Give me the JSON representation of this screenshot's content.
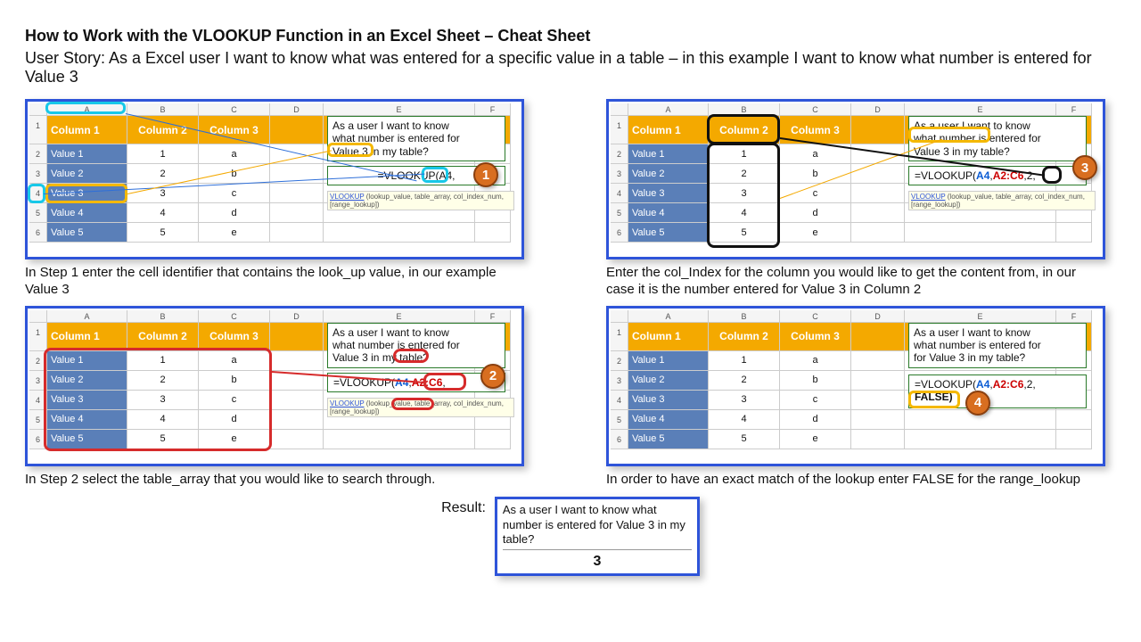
{
  "title": "How to Work with the VLOOKUP Function in an Excel Sheet – Cheat Sheet",
  "story": "User Story: As a Excel user I want to know what was entered for a specific value in a table – in this example I want to know what number is entered for Value 3",
  "columns": {
    "A": "A",
    "B": "B",
    "C": "C",
    "D": "D",
    "E": "E",
    "F": "F"
  },
  "rows": [
    "1",
    "2",
    "3",
    "4",
    "5",
    "6"
  ],
  "table": {
    "headers": {
      "c1": "Column 1",
      "c2": "Column 2",
      "c3": "Column 3"
    },
    "data": [
      {
        "c1": "Value 1",
        "c2": "1",
        "c3": "a"
      },
      {
        "c1": "Value 2",
        "c2": "2",
        "c3": "b"
      },
      {
        "c1": "Value 3",
        "c2": "3",
        "c3": "c"
      },
      {
        "c1": "Value 4",
        "c2": "4",
        "c3": "d"
      },
      {
        "c1": "Value 5",
        "c2": "5",
        "c3": "e"
      }
    ]
  },
  "storybox": {
    "line_full": "As a user I want to know what number is entered for Value 3 in my table?",
    "line_a": "As a user I want to know",
    "line_b": "what number is entered for",
    "line_c": "Value 3 in my table?",
    "line_c_prefix": "Value 3",
    "line_c_suffix": " in my table?",
    "line_b4": "for Value 3 in my table?"
  },
  "formula": {
    "s1": "=VLOOKUP(A4,",
    "s2_pre": "=VLOOKUP(",
    "s2_a": "A4",
    "s2_mid": ",",
    "s2_b": "A2:C6",
    "s2_end": ",",
    "s3_pre": "=VLOOKUP(",
    "s3_a": "A4",
    "s3_mid": ",",
    "s3_b": "A2:C6",
    "s3_c": ",2,",
    "s4_pre": "=VLOOKUP(",
    "s4_a": "A4",
    "s4_mid": ",",
    "s4_b": "A2:C6",
    "s4_c": ",2,",
    "s4_false": "FALSE)",
    "tooltip_link": "VLOOKUP",
    "tooltip_rest": " (lookup_value, table_array, col_index_num, [range_lookup])"
  },
  "captions": {
    "c1": "In Step 1 enter the cell identifier that contains the look_up value, in our example Value 3",
    "c2": "In Step 2 select the table_array that you would like to search through.",
    "c3": "Enter the col_Index for the column you would like to get the content from, in our case it is the number entered for Value 3 in Column 2",
    "c4": "In order to have an exact match of the lookup enter FALSE for the range_lookup"
  },
  "badges": {
    "b1": "1",
    "b2": "2",
    "b3": "3",
    "b4": "4"
  },
  "result": {
    "label": "Result:",
    "value": "3"
  }
}
